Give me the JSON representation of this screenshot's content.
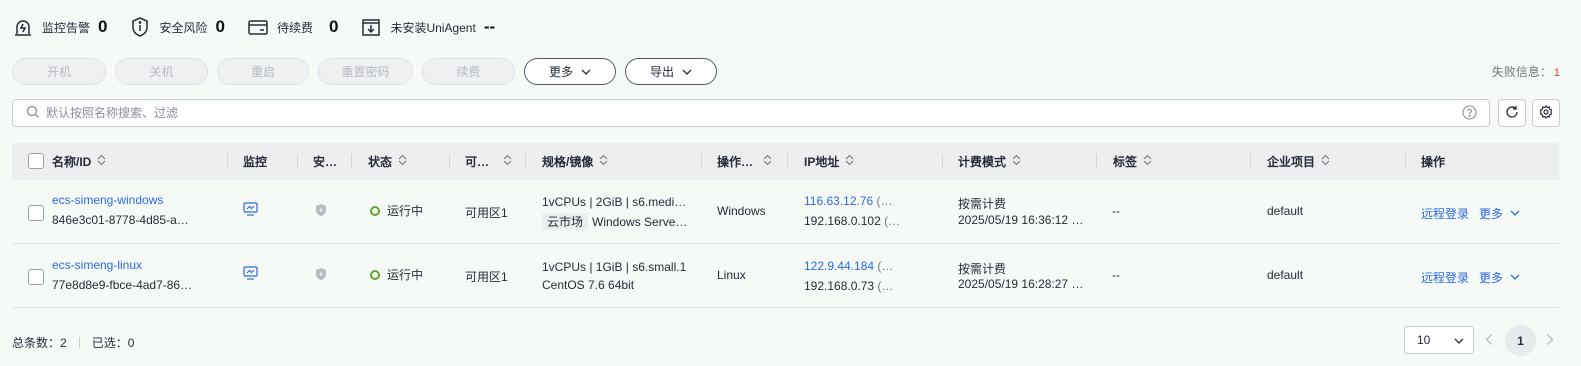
{
  "summary": [
    {
      "label": "监控告警",
      "count": "0",
      "icon": "alarm-icon"
    },
    {
      "label": "安全风险",
      "count": "0",
      "icon": "shield-info-icon"
    },
    {
      "label": "待续费",
      "count": "0",
      "icon": "wallet-icon"
    },
    {
      "label": "未安装UniAgent",
      "count": "--",
      "icon": "download-box-icon"
    }
  ],
  "toolbar": {
    "buttons": [
      "开机",
      "关机",
      "重启",
      "重置密码",
      "续费"
    ],
    "more_label": "更多",
    "export_label": "导出",
    "fail_label": "失败信息：",
    "fail_count": "1"
  },
  "search": {
    "placeholder": "默认按照名称搜索、过滤"
  },
  "table": {
    "columns": [
      "名称/ID",
      "监控",
      "安…",
      "状态",
      "可…",
      "规格/镜像",
      "操作…",
      "IP地址",
      "计费模式",
      "标签",
      "企业项目",
      "操作"
    ],
    "rows": [
      {
        "name": "ecs-simeng-windows",
        "id": "846e3c01-8778-4d85-a…",
        "status": "运行中",
        "az": "可用区1",
        "spec": "1vCPUs | 2GiB | s6.medi…",
        "image_tag": "云市场",
        "image": "Windows Serve…",
        "os": "Windows",
        "ip_public": "116.63.12.76",
        "ip_public_suffix": "(…",
        "ip_private": "192.168.0.102",
        "ip_private_suffix": "(…",
        "billing": "按需计费",
        "billing_time": "2025/05/19 16:36:12 …",
        "tags": "--",
        "project": "default",
        "action_login": "远程登录",
        "action_more": "更多"
      },
      {
        "name": "ecs-simeng-linux",
        "id": "77e8d8e9-fbce-4ad7-86…",
        "status": "运行中",
        "az": "可用区1",
        "spec": "1vCPUs | 1GiB | s6.small.1",
        "image_tag": "",
        "image": "CentOS 7.6 64bit",
        "os": "Linux",
        "ip_public": "122.9.44.184",
        "ip_public_suffix": "(…",
        "ip_private": "192.168.0.73",
        "ip_private_suffix": "(…",
        "billing": "按需计费",
        "billing_time": "2025/05/19 16:28:27 …",
        "tags": "--",
        "project": "default",
        "action_login": "远程登录",
        "action_more": "更多"
      }
    ]
  },
  "footer": {
    "total_label": "总条数：2",
    "selected_label": "已选：0",
    "page_size": "10",
    "current_page": "1"
  },
  "colors": {
    "accent": "#2a6ae6",
    "running": "#62a82e",
    "error": "#e0353b"
  }
}
